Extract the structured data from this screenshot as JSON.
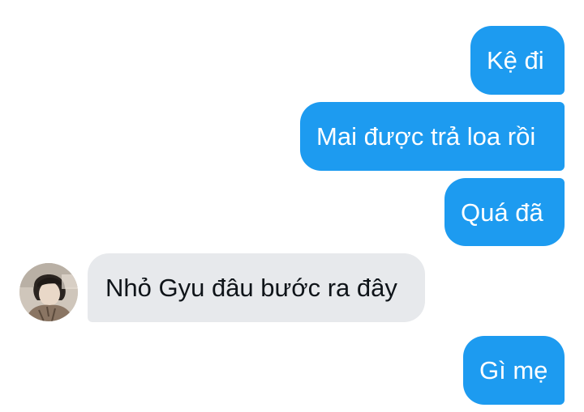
{
  "messages": [
    {
      "direction": "sent",
      "text": "Kệ đi"
    },
    {
      "direction": "sent",
      "text": "Mai được trả loa rồi"
    },
    {
      "direction": "sent",
      "text": "Quá đã"
    },
    {
      "direction": "received",
      "text": "Nhỏ Gyu đâu bước ra đây"
    },
    {
      "direction": "sent",
      "text": "Gì mẹ"
    }
  ],
  "colors": {
    "sent_bubble": "#1d9bf0",
    "received_bubble": "#e7e9ec",
    "background": "#ffffff"
  },
  "icons": {
    "contact_avatar": "person-avatar-photo"
  }
}
